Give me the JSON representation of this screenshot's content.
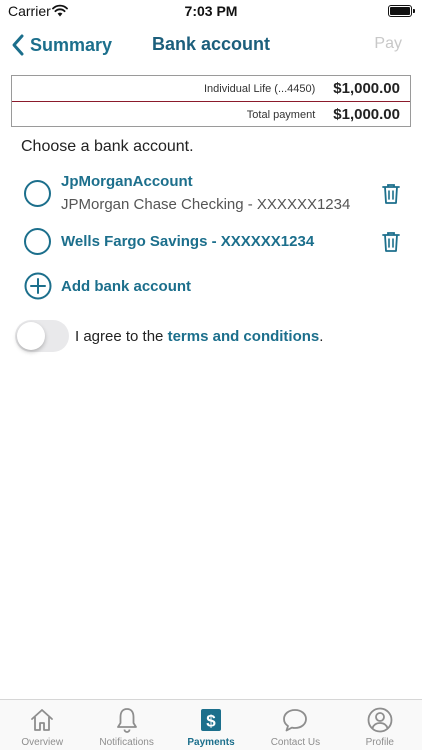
{
  "status_bar": {
    "carrier": "Carrier",
    "time": "7:03 PM"
  },
  "nav": {
    "back_label": "Summary",
    "title": "Bank account",
    "action_label": "Pay"
  },
  "summary": {
    "policy_label": "Individual Life (...4450)",
    "policy_amount": "$1,000.00",
    "total_label": "Total payment",
    "total_amount": "$1,000.00"
  },
  "prompt": "Choose a bank account.",
  "accounts": [
    {
      "name": "JpMorganAccount",
      "detail": "JPMorgan Chase Checking - XXXXXX1234"
    },
    {
      "name": "Wells Fargo Savings - XXXXXX1234"
    }
  ],
  "add_account_label": "Add bank account",
  "agreement": {
    "prefix": "I agree to the ",
    "link": "terms and conditions",
    "suffix": "."
  },
  "colors": {
    "accent": "#1c6f8c",
    "divider": "#8b1a2b",
    "disabled": "#c8c8c8"
  },
  "tabs": [
    {
      "label": "Overview",
      "icon": "home-icon",
      "active": false
    },
    {
      "label": "Notifications",
      "icon": "bell-icon",
      "active": false
    },
    {
      "label": "Payments",
      "icon": "dollar-icon",
      "active": true
    },
    {
      "label": "Contact Us",
      "icon": "chat-bubble-icon",
      "active": false
    },
    {
      "label": "Profile",
      "icon": "profile-icon",
      "active": false
    }
  ]
}
